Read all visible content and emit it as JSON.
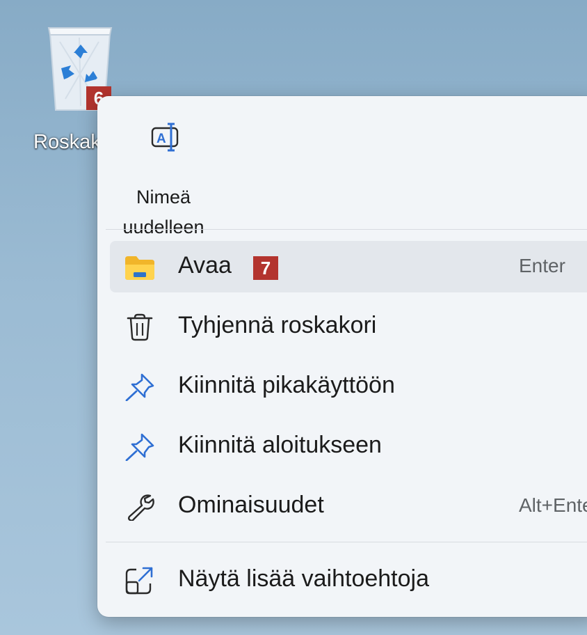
{
  "desktop": {
    "recycle_bin_label": "Roskakori",
    "marker_6": "6"
  },
  "menu": {
    "rename_label_line1": "Nimeä",
    "rename_label_line2": "uudelleen",
    "items": [
      {
        "label": "Avaa",
        "shortcut": "Enter",
        "icon": "folder-icon",
        "marker": "7"
      },
      {
        "label": "Tyhjennä roskakori",
        "shortcut": "",
        "icon": "trash-icon"
      },
      {
        "label": "Kiinnitä pikakäyttöön",
        "shortcut": "",
        "icon": "pin-icon"
      },
      {
        "label": "Kiinnitä aloitukseen",
        "shortcut": "",
        "icon": "pin-icon"
      },
      {
        "label": "Ominaisuudet",
        "shortcut": "Alt+Enter",
        "icon": "wrench-icon"
      }
    ],
    "more_options": {
      "label": "Näytä lisää vaihtoehtoja",
      "icon": "open-external-icon"
    }
  },
  "colors": {
    "marker_bg": "#b3342e",
    "pin_blue": "#2f6fd3",
    "menu_bg": "#f2f5f8",
    "hover_bg": "#e3e7ec"
  }
}
